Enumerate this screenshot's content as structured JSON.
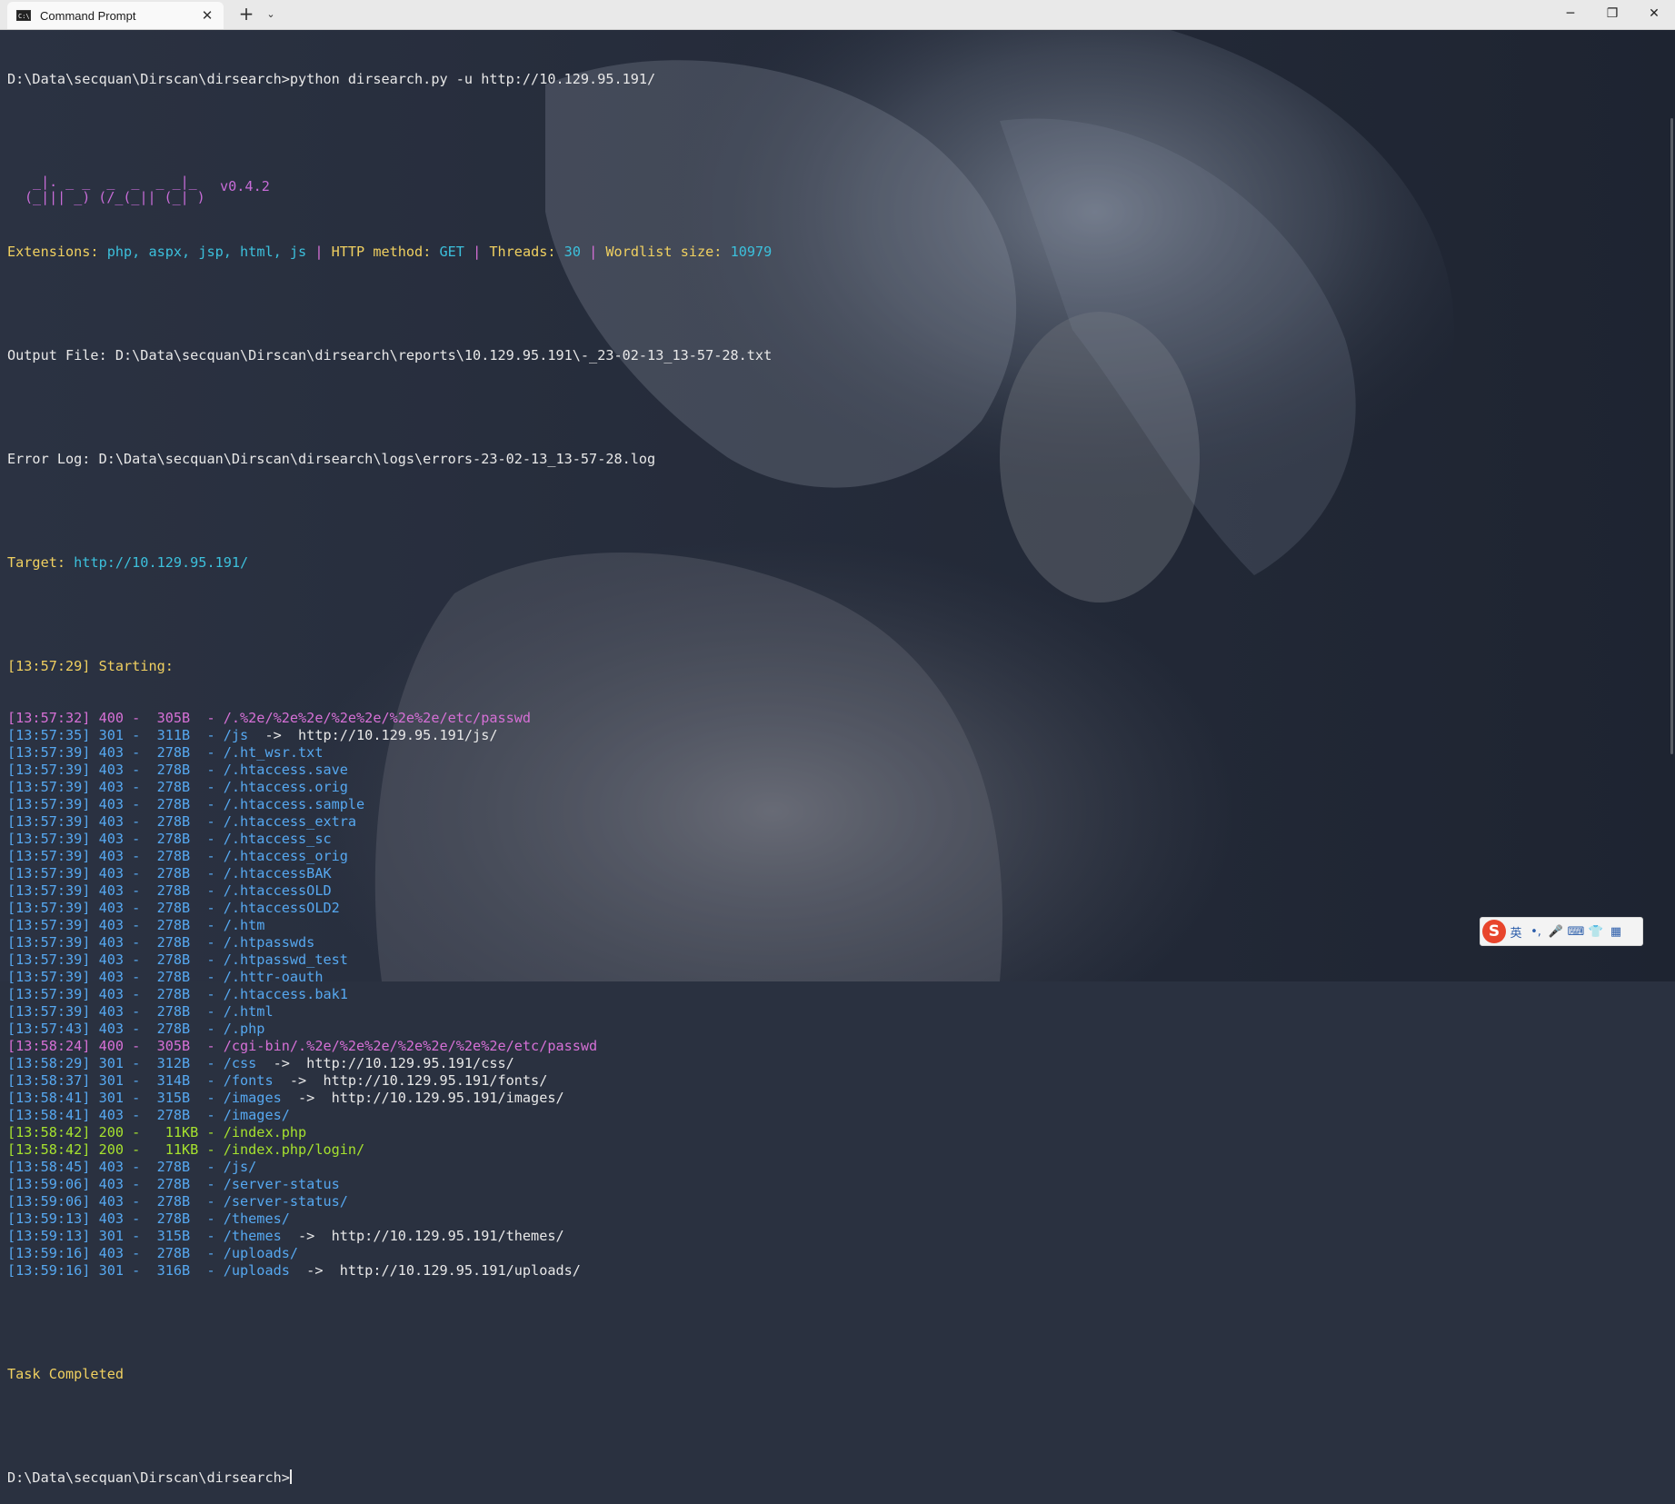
{
  "window": {
    "tab_title": "Command Prompt",
    "tab_icon": "C:\\",
    "close_tab_glyph": "✕",
    "new_tab_glyph": "+",
    "dropdown_glyph": "⌄",
    "minimize_glyph": "─",
    "restore_glyph": "❐",
    "close_glyph": "✕"
  },
  "terminal": {
    "command_line": "D:\\Data\\secquan\\Dirscan\\dirsearch>python dirsearch.py -u http://10.129.95.191/",
    "banner_art": "  _|. _ _  _  _  _ _|_\n (_||| _) (/_(_|| (_| )",
    "version": "v0.4.2",
    "config": {
      "ext_label": "Extensions: ",
      "ext_value": "php, aspx, jsp, html, js",
      "sep": " | ",
      "method_label": "HTTP method: ",
      "method_value": "GET",
      "threads_label": "Threads: ",
      "threads_value": "30",
      "wordlist_label": "Wordlist size: ",
      "wordlist_value": "10979"
    },
    "output_file": "Output File: D:\\Data\\secquan\\Dirscan\\dirsearch\\reports\\10.129.95.191\\-_23-02-13_13-57-28.txt",
    "error_log": "Error Log: D:\\Data\\secquan\\Dirscan\\dirsearch\\logs\\errors-23-02-13_13-57-28.log",
    "target_label": "Target: ",
    "target_value": "http://10.129.95.191/",
    "starting": "[13:57:29] Starting:",
    "results": [
      {
        "text": "[13:57:32] 400 -  305B  - /.%2e/%2e%2e/%2e%2e/%2e%2e/etc/passwd",
        "color": "magenta",
        "redirect": ""
      },
      {
        "text": "[13:57:35] 301 -  311B  - /js  ",
        "color": "blue",
        "redirect": "->  http://10.129.95.191/js/"
      },
      {
        "text": "[13:57:39] 403 -  278B  - /.ht_wsr.txt",
        "color": "blue",
        "redirect": ""
      },
      {
        "text": "[13:57:39] 403 -  278B  - /.htaccess.save",
        "color": "blue",
        "redirect": ""
      },
      {
        "text": "[13:57:39] 403 -  278B  - /.htaccess.orig",
        "color": "blue",
        "redirect": ""
      },
      {
        "text": "[13:57:39] 403 -  278B  - /.htaccess.sample",
        "color": "blue",
        "redirect": ""
      },
      {
        "text": "[13:57:39] 403 -  278B  - /.htaccess_extra",
        "color": "blue",
        "redirect": ""
      },
      {
        "text": "[13:57:39] 403 -  278B  - /.htaccess_sc",
        "color": "blue",
        "redirect": ""
      },
      {
        "text": "[13:57:39] 403 -  278B  - /.htaccess_orig",
        "color": "blue",
        "redirect": ""
      },
      {
        "text": "[13:57:39] 403 -  278B  - /.htaccessBAK",
        "color": "blue",
        "redirect": ""
      },
      {
        "text": "[13:57:39] 403 -  278B  - /.htaccessOLD",
        "color": "blue",
        "redirect": ""
      },
      {
        "text": "[13:57:39] 403 -  278B  - /.htaccessOLD2",
        "color": "blue",
        "redirect": ""
      },
      {
        "text": "[13:57:39] 403 -  278B  - /.htm",
        "color": "blue",
        "redirect": ""
      },
      {
        "text": "[13:57:39] 403 -  278B  - /.htpasswds",
        "color": "blue",
        "redirect": ""
      },
      {
        "text": "[13:57:39] 403 -  278B  - /.htpasswd_test",
        "color": "blue",
        "redirect": ""
      },
      {
        "text": "[13:57:39] 403 -  278B  - /.httr-oauth",
        "color": "blue",
        "redirect": ""
      },
      {
        "text": "[13:57:39] 403 -  278B  - /.htaccess.bak1",
        "color": "blue",
        "redirect": ""
      },
      {
        "text": "[13:57:39] 403 -  278B  - /.html",
        "color": "blue",
        "redirect": ""
      },
      {
        "text": "[13:57:43] 403 -  278B  - /.php",
        "color": "blue",
        "redirect": ""
      },
      {
        "text": "[13:58:24] 400 -  305B  - /cgi-bin/.%2e/%2e%2e/%2e%2e/%2e%2e/etc/passwd",
        "color": "magenta",
        "redirect": ""
      },
      {
        "text": "[13:58:29] 301 -  312B  - /css  ",
        "color": "blue",
        "redirect": "->  http://10.129.95.191/css/"
      },
      {
        "text": "[13:58:37] 301 -  314B  - /fonts  ",
        "color": "blue",
        "redirect": "->  http://10.129.95.191/fonts/"
      },
      {
        "text": "[13:58:41] 301 -  315B  - /images  ",
        "color": "blue",
        "redirect": "->  http://10.129.95.191/images/"
      },
      {
        "text": "[13:58:41] 403 -  278B  - /images/",
        "color": "blue",
        "redirect": ""
      },
      {
        "text": "[13:58:42] 200 -   11KB - /index.php",
        "color": "green",
        "redirect": ""
      },
      {
        "text": "[13:58:42] 200 -   11KB - /index.php/login/",
        "color": "green",
        "redirect": ""
      },
      {
        "text": "[13:58:45] 403 -  278B  - /js/",
        "color": "blue",
        "redirect": ""
      },
      {
        "text": "[13:59:06] 403 -  278B  - /server-status",
        "color": "blue",
        "redirect": ""
      },
      {
        "text": "[13:59:06] 403 -  278B  - /server-status/",
        "color": "blue",
        "redirect": ""
      },
      {
        "text": "[13:59:13] 403 -  278B  - /themes/",
        "color": "blue",
        "redirect": ""
      },
      {
        "text": "[13:59:13] 301 -  315B  - /themes  ",
        "color": "blue",
        "redirect": "->  http://10.129.95.191/themes/"
      },
      {
        "text": "[13:59:16] 403 -  278B  - /uploads/",
        "color": "blue",
        "redirect": ""
      },
      {
        "text": "[13:59:16] 301 -  316B  - /uploads  ",
        "color": "blue",
        "redirect": "->  http://10.129.95.191/uploads/"
      }
    ],
    "task_completed": "Task Completed",
    "prompt": "D:\\Data\\secquan\\Dirscan\\dirsearch>"
  },
  "ime": {
    "logo": "S",
    "lang": "英",
    "punct": "•,",
    "mic": "🎤",
    "keyboard": "⌨",
    "skin": "👕",
    "apps": "▦"
  },
  "colors": {
    "yellow": "#f0d060",
    "cyan": "#3cc0dc",
    "magenta": "#d670d6",
    "blue": "#56a8f0",
    "green": "#a6e22e",
    "white": "#e8e8e8"
  }
}
